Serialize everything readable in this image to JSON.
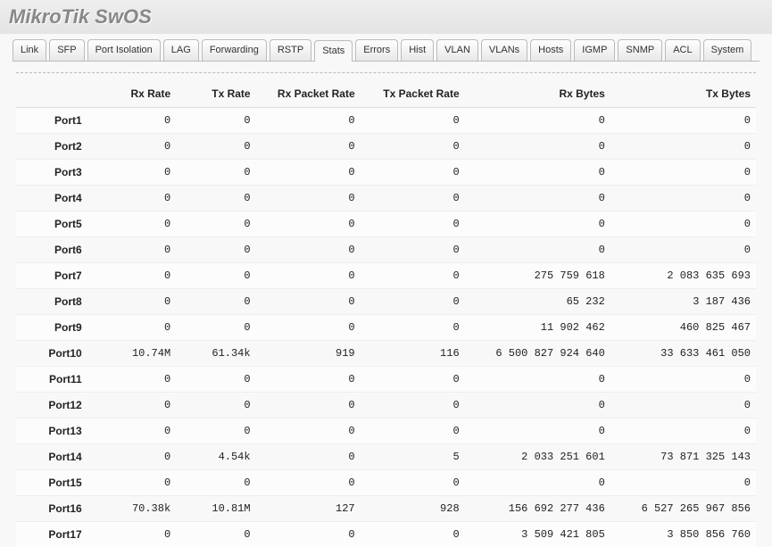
{
  "header": {
    "title": "MikroTik SwOS"
  },
  "tabs": {
    "items": [
      "Link",
      "SFP",
      "Port Isolation",
      "LAG",
      "Forwarding",
      "RSTP",
      "Stats",
      "Errors",
      "Hist",
      "VLAN",
      "VLANs",
      "Hosts",
      "IGMP",
      "SNMP",
      "ACL",
      "System"
    ],
    "active_index": 6
  },
  "table": {
    "columns": [
      "",
      "Rx Rate",
      "Tx Rate",
      "Rx Packet Rate",
      "Tx Packet Rate",
      "Rx Bytes",
      "Tx Bytes"
    ],
    "rows": [
      {
        "port": "Port1",
        "rx_rate": "0",
        "tx_rate": "0",
        "rx_pkt": "0",
        "tx_pkt": "0",
        "rx_bytes": "0",
        "tx_bytes": "0"
      },
      {
        "port": "Port2",
        "rx_rate": "0",
        "tx_rate": "0",
        "rx_pkt": "0",
        "tx_pkt": "0",
        "rx_bytes": "0",
        "tx_bytes": "0"
      },
      {
        "port": "Port3",
        "rx_rate": "0",
        "tx_rate": "0",
        "rx_pkt": "0",
        "tx_pkt": "0",
        "rx_bytes": "0",
        "tx_bytes": "0"
      },
      {
        "port": "Port4",
        "rx_rate": "0",
        "tx_rate": "0",
        "rx_pkt": "0",
        "tx_pkt": "0",
        "rx_bytes": "0",
        "tx_bytes": "0"
      },
      {
        "port": "Port5",
        "rx_rate": "0",
        "tx_rate": "0",
        "rx_pkt": "0",
        "tx_pkt": "0",
        "rx_bytes": "0",
        "tx_bytes": "0"
      },
      {
        "port": "Port6",
        "rx_rate": "0",
        "tx_rate": "0",
        "rx_pkt": "0",
        "tx_pkt": "0",
        "rx_bytes": "0",
        "tx_bytes": "0"
      },
      {
        "port": "Port7",
        "rx_rate": "0",
        "tx_rate": "0",
        "rx_pkt": "0",
        "tx_pkt": "0",
        "rx_bytes": "275 759 618",
        "tx_bytes": "2 083 635 693"
      },
      {
        "port": "Port8",
        "rx_rate": "0",
        "tx_rate": "0",
        "rx_pkt": "0",
        "tx_pkt": "0",
        "rx_bytes": "65 232",
        "tx_bytes": "3 187 436"
      },
      {
        "port": "Port9",
        "rx_rate": "0",
        "tx_rate": "0",
        "rx_pkt": "0",
        "tx_pkt": "0",
        "rx_bytes": "11 902 462",
        "tx_bytes": "460 825 467"
      },
      {
        "port": "Port10",
        "rx_rate": "10.74M",
        "tx_rate": "61.34k",
        "rx_pkt": "919",
        "tx_pkt": "116",
        "rx_bytes": "6 500 827 924 640",
        "tx_bytes": "33 633 461 050"
      },
      {
        "port": "Port11",
        "rx_rate": "0",
        "tx_rate": "0",
        "rx_pkt": "0",
        "tx_pkt": "0",
        "rx_bytes": "0",
        "tx_bytes": "0"
      },
      {
        "port": "Port12",
        "rx_rate": "0",
        "tx_rate": "0",
        "rx_pkt": "0",
        "tx_pkt": "0",
        "rx_bytes": "0",
        "tx_bytes": "0"
      },
      {
        "port": "Port13",
        "rx_rate": "0",
        "tx_rate": "0",
        "rx_pkt": "0",
        "tx_pkt": "0",
        "rx_bytes": "0",
        "tx_bytes": "0"
      },
      {
        "port": "Port14",
        "rx_rate": "0",
        "tx_rate": "4.54k",
        "rx_pkt": "0",
        "tx_pkt": "5",
        "rx_bytes": "2 033 251 601",
        "tx_bytes": "73 871 325 143"
      },
      {
        "port": "Port15",
        "rx_rate": "0",
        "tx_rate": "0",
        "rx_pkt": "0",
        "tx_pkt": "0",
        "rx_bytes": "0",
        "tx_bytes": "0"
      },
      {
        "port": "Port16",
        "rx_rate": "70.38k",
        "tx_rate": "10.81M",
        "rx_pkt": "127",
        "tx_pkt": "928",
        "rx_bytes": "156 692 277 436",
        "tx_bytes": "6 527 265 967 856"
      },
      {
        "port": "Port17",
        "rx_rate": "0",
        "tx_rate": "0",
        "rx_pkt": "0",
        "tx_pkt": "0",
        "rx_bytes": "3 509 421 805",
        "tx_bytes": "3 850 856 760"
      }
    ]
  }
}
